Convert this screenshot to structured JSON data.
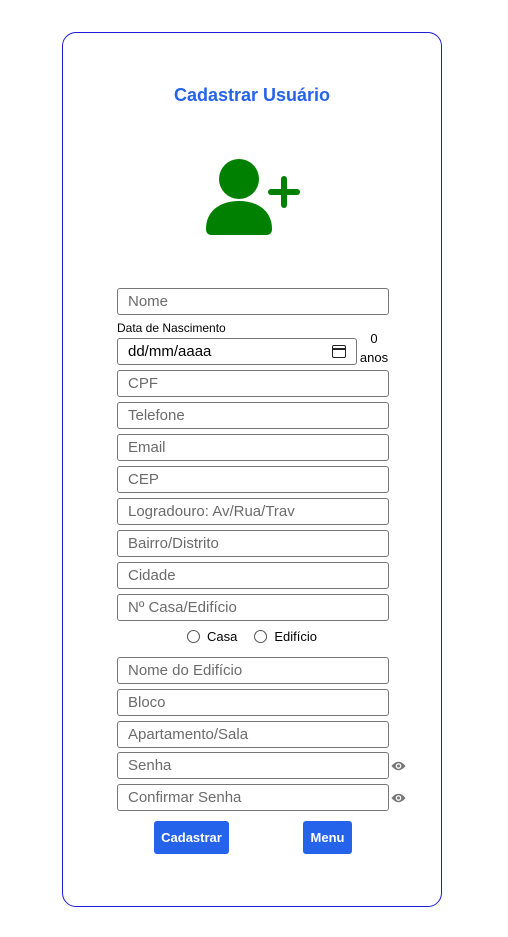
{
  "form": {
    "title": "Cadastrar Usuário",
    "nome_placeholder": "Nome",
    "data_nascimento_label": "Data de Nascimento",
    "data_nascimento_value": "dd/mm/aaaa",
    "idade_value": "0",
    "idade_unit": "anos",
    "cpf_placeholder": "CPF",
    "telefone_placeholder": "Telefone",
    "email_placeholder": "Email",
    "cep_placeholder": "CEP",
    "logradouro_placeholder": "Logradouro: Av/Rua/Trav",
    "bairro_placeholder": "Bairro/Distrito",
    "cidade_placeholder": "Cidade",
    "numero_placeholder": "Nº Casa/Edifício",
    "tipo_options": [
      "Casa",
      "Edifício"
    ],
    "nome_edificio_placeholder": "Nome do Edifício",
    "bloco_placeholder": "Bloco",
    "apartamento_placeholder": "Apartamento/Sala",
    "senha_placeholder": "Senha",
    "confirmar_senha_placeholder": "Confirmar Senha"
  },
  "buttons": {
    "cadastrar": "Cadastrar",
    "menu": "Menu"
  },
  "icons": {
    "avatar": "add-user-icon",
    "password_toggle": "eye-icon",
    "calendar": "calendar-icon"
  },
  "colors": {
    "accent": "#2563eb",
    "icon_green": "#008000",
    "card_border": "#1e1ed8"
  }
}
